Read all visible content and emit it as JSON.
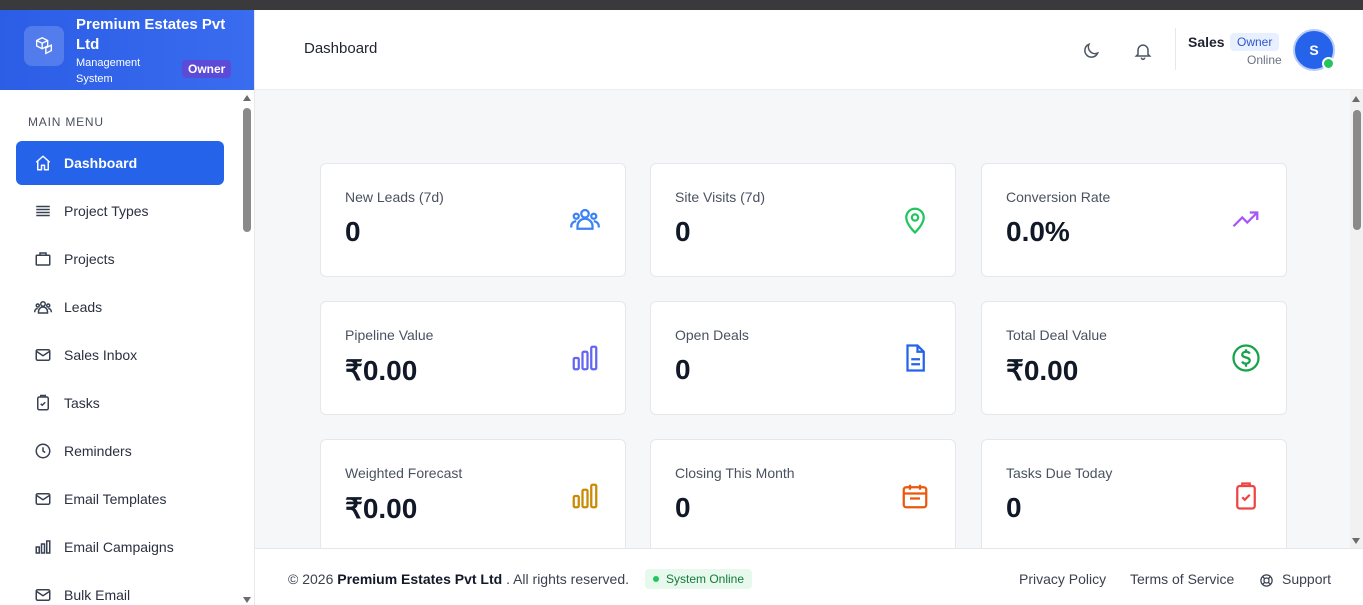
{
  "brand": {
    "name": "Premium Estates Pvt Ltd",
    "subtitle": "Management System",
    "badge": "Owner"
  },
  "sidebar": {
    "section_title": "MAIN MENU",
    "items": [
      {
        "label": "Dashboard",
        "icon": "home-icon",
        "active": true
      },
      {
        "label": "Project Types",
        "icon": "list-icon"
      },
      {
        "label": "Projects",
        "icon": "briefcase-icon"
      },
      {
        "label": "Leads",
        "icon": "users-icon"
      },
      {
        "label": "Sales Inbox",
        "icon": "mail-icon"
      },
      {
        "label": "Tasks",
        "icon": "clipboard-check-icon"
      },
      {
        "label": "Reminders",
        "icon": "clock-icon"
      },
      {
        "label": "Email Templates",
        "icon": "mail-icon"
      },
      {
        "label": "Email Campaigns",
        "icon": "bar-chart-icon"
      },
      {
        "label": "Bulk Email",
        "icon": "mail-icon"
      }
    ]
  },
  "header": {
    "title": "Dashboard",
    "user": {
      "name": "Sales",
      "role": "Owner",
      "status": "Online",
      "initial": "S"
    }
  },
  "cards": [
    {
      "label": "New Leads (7d)",
      "value": "0",
      "icon": "users-icon",
      "color": "#3b82f6"
    },
    {
      "label": "Site Visits (7d)",
      "value": "0",
      "icon": "map-pin-icon",
      "color": "#22c55e"
    },
    {
      "label": "Conversion Rate",
      "value": "0.0%",
      "icon": "trending-up-icon",
      "color": "#a855f7"
    },
    {
      "label": "Pipeline Value",
      "value": "₹0.00",
      "icon": "bar-chart-icon",
      "color": "#6366f1"
    },
    {
      "label": "Open Deals",
      "value": "0",
      "icon": "document-icon",
      "color": "#2563eb"
    },
    {
      "label": "Total Deal Value",
      "value": "₹0.00",
      "icon": "dollar-circle-icon",
      "color": "#16a34a"
    },
    {
      "label": "Weighted Forecast",
      "value": "₹0.00",
      "icon": "bar-chart-icon",
      "color": "#ca8a04"
    },
    {
      "label": "Closing This Month",
      "value": "0",
      "icon": "calendar-icon",
      "color": "#ea580c"
    },
    {
      "label": "Tasks Due Today",
      "value": "0",
      "icon": "clipboard-check-icon",
      "color": "#ef4444"
    }
  ],
  "footer": {
    "copyright_prefix": "© 2026",
    "company": "Premium Estates Pvt Ltd",
    "copyright_suffix": ". All rights reserved.",
    "system_status": "System Online",
    "links": [
      "Privacy Policy",
      "Terms of Service",
      "Support"
    ]
  },
  "colors": {
    "accent": "#2563eb",
    "online": "#22c55e"
  }
}
